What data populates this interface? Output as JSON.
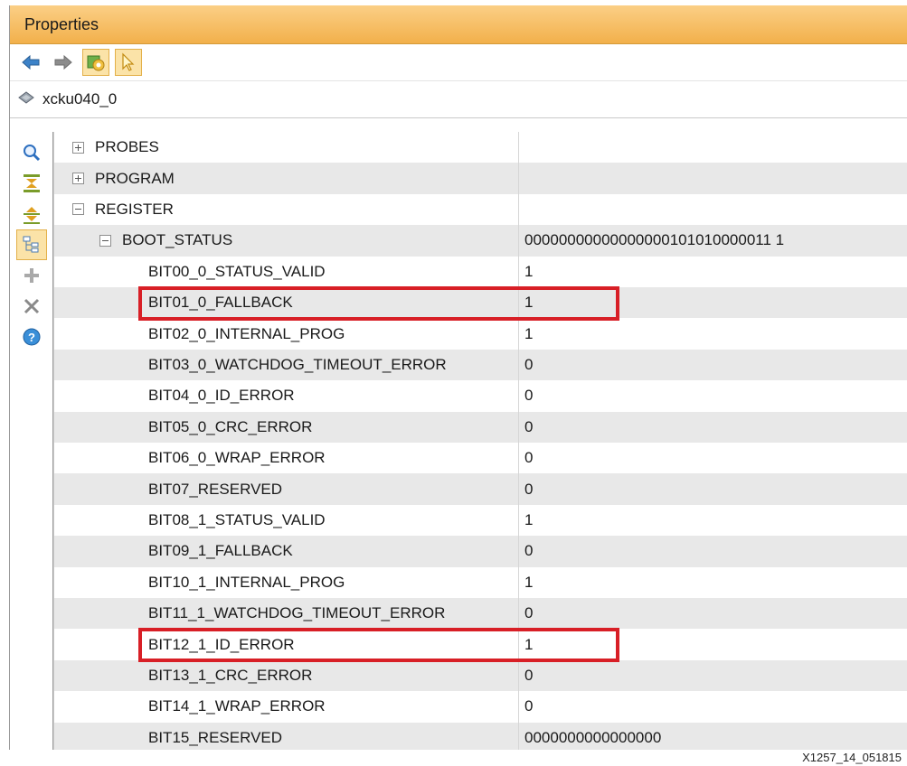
{
  "window": {
    "title": "Properties"
  },
  "toolbar": {
    "buttons": [
      "back-arrow-icon",
      "forward-arrow-icon",
      "refresh-device-icon",
      "select-cursor-icon"
    ]
  },
  "object": {
    "name": "xcku040_0",
    "icon": "device-chip-icon"
  },
  "side_tools": [
    "search-icon",
    "collapse-all-icon",
    "expand-all-icon",
    "group-by-category-icon",
    "add-icon",
    "remove-icon",
    "help-icon"
  ],
  "tree": {
    "probes": {
      "label": "PROBES",
      "value": ""
    },
    "program": {
      "label": "PROGRAM",
      "value": ""
    },
    "register": {
      "label": "REGISTER",
      "value": ""
    },
    "boot_status": {
      "label": "BOOT_STATUS",
      "value": "00000000000000000101010000011 1"
    },
    "bits": [
      {
        "label": "BIT00_0_STATUS_VALID",
        "value": "1"
      },
      {
        "label": "BIT01_0_FALLBACK",
        "value": "1"
      },
      {
        "label": "BIT02_0_INTERNAL_PROG",
        "value": "1"
      },
      {
        "label": "BIT03_0_WATCHDOG_TIMEOUT_ERROR",
        "value": "0"
      },
      {
        "label": "BIT04_0_ID_ERROR",
        "value": "0"
      },
      {
        "label": "BIT05_0_CRC_ERROR",
        "value": "0"
      },
      {
        "label": "BIT06_0_WRAP_ERROR",
        "value": "0"
      },
      {
        "label": "BIT07_RESERVED",
        "value": "0"
      },
      {
        "label": "BIT08_1_STATUS_VALID",
        "value": "1"
      },
      {
        "label": "BIT09_1_FALLBACK",
        "value": "0"
      },
      {
        "label": "BIT10_1_INTERNAL_PROG",
        "value": "1"
      },
      {
        "label": "BIT11_1_WATCHDOG_TIMEOUT_ERROR",
        "value": "0"
      },
      {
        "label": "BIT12_1_ID_ERROR",
        "value": "1"
      },
      {
        "label": "BIT13_1_CRC_ERROR",
        "value": "0"
      },
      {
        "label": "BIT14_1_WRAP_ERROR",
        "value": "0"
      },
      {
        "label": "BIT15_RESERVED",
        "value": "0000000000000000"
      }
    ]
  },
  "colors": {
    "highlight": "#d81f26",
    "titlebar": "#f2b04b",
    "row_shade": "#e8e8e8"
  },
  "figure_label": "X1257_14_051815"
}
